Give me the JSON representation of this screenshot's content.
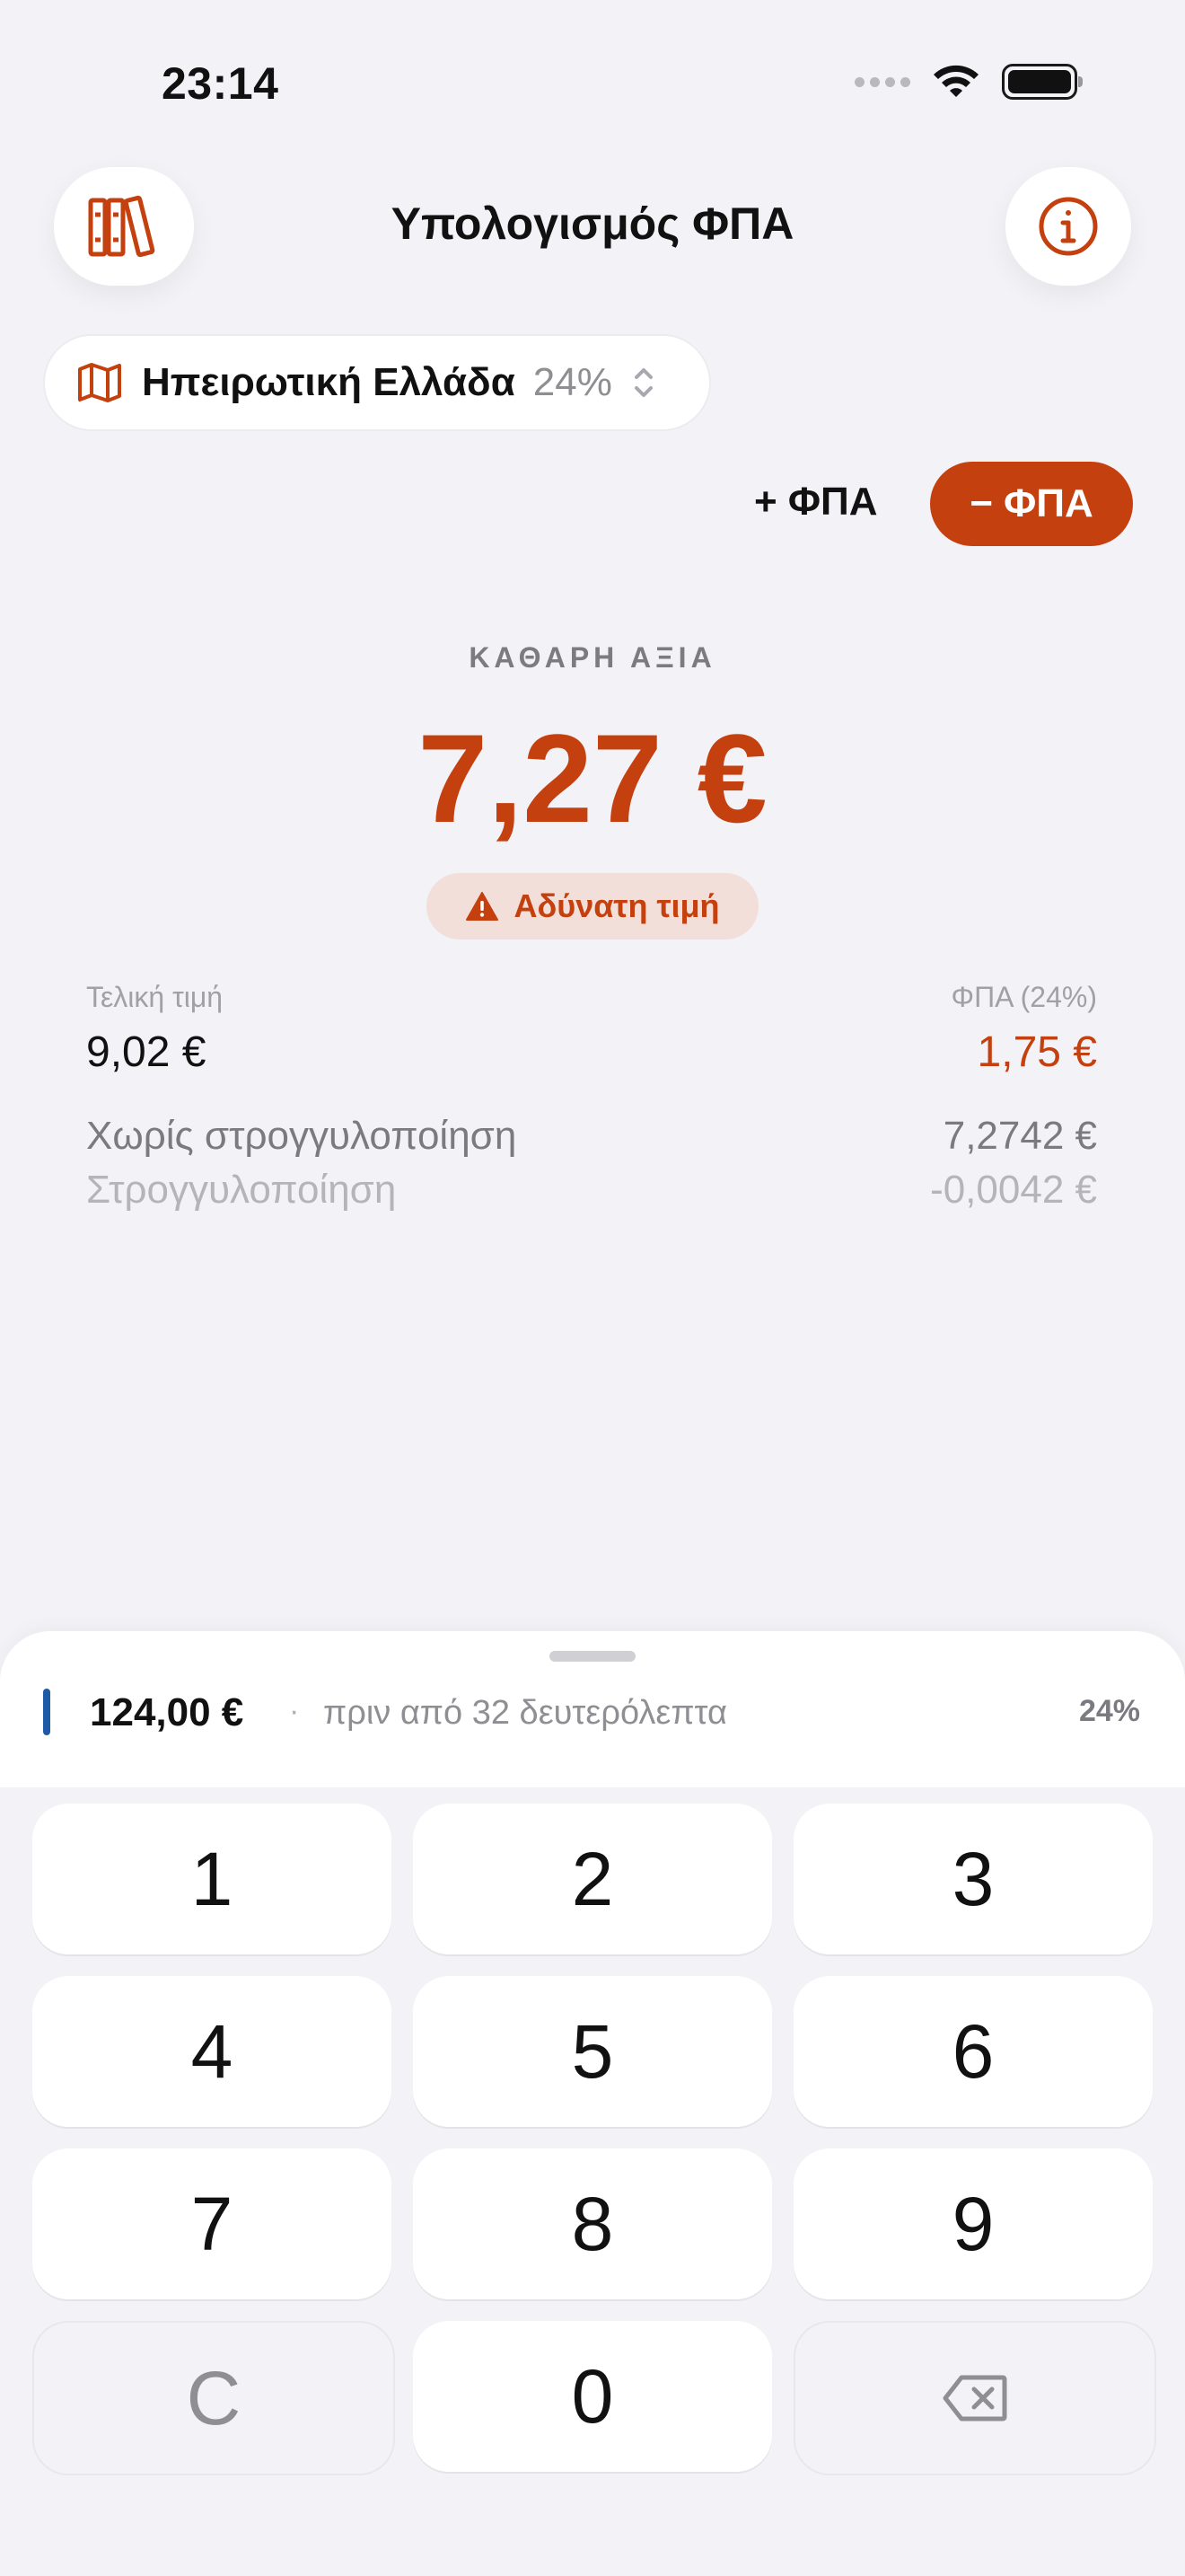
{
  "status_bar": {
    "time": "23:14"
  },
  "nav": {
    "title": "Υπολογισμός ΦΠΑ",
    "library_icon": "books-icon",
    "info_icon": "info-icon"
  },
  "region": {
    "name": "Ηπειρωτική Ελλάδα",
    "rate": "24%",
    "icon": "map-icon"
  },
  "mode": {
    "add_label": "+ ΦΠΑ",
    "remove_label": "− ΦΠΑ",
    "active": "remove"
  },
  "result": {
    "label": "ΚΑΘΑΡΗ ΑΞΙΑ",
    "value": "7,27 €",
    "warning": "Αδύνατη τιμή"
  },
  "breakdown": {
    "final_label": "Τελική τιμή",
    "final_value": "9,02 €",
    "vat_label": "ΦΠΑ (24%)",
    "vat_value": "1,75 €",
    "unrounded_label": "Χωρίς στρογγυλοποίηση",
    "unrounded_value": "7,2742 €",
    "rounding_label": "Στρογγυλοποίηση",
    "rounding_value": "-0,0042 €"
  },
  "history": {
    "amount": "124,00 €",
    "separator": "·",
    "time_ago": "πριν από 32 δευτερόλεπτα",
    "rate": "24%"
  },
  "keypad": {
    "keys": [
      "1",
      "2",
      "3",
      "4",
      "5",
      "6",
      "7",
      "8",
      "9",
      "C",
      "0"
    ],
    "backspace_icon": "backspace-icon"
  },
  "colors": {
    "accent": "#c4400f",
    "history_mark": "#1f5aa6",
    "background": "#f2f2f7"
  }
}
